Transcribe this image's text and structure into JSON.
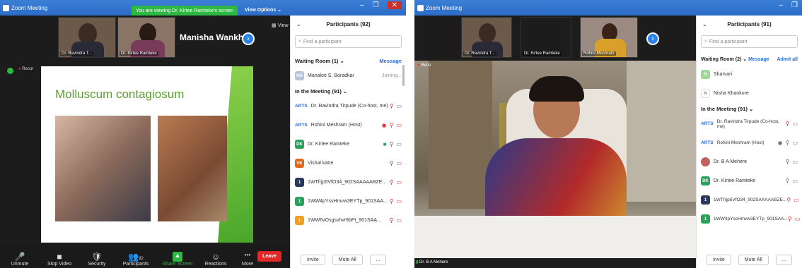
{
  "left": {
    "titlebar": "Zoom Meeting",
    "banner": "You are viewing Dr. Kirtee Ramteke's screen",
    "view_options": "View Options ⌄",
    "view_label": "View",
    "tiles": [
      {
        "name": "Dr. Ravindra T..."
      },
      {
        "name": "Dr. Kirtee Ramteke"
      }
    ],
    "big_name": "Manisha Wankh...",
    "recording": "Recor",
    "slide_title": "Molluscum contagiosum",
    "toolbar": [
      {
        "label": "Unmute",
        "icon": "🎤"
      },
      {
        "label": "Stop Video",
        "icon": "■"
      },
      {
        "label": "Security",
        "icon": "🛡"
      },
      {
        "label": "Participants",
        "icon": "👥",
        "count": "92"
      },
      {
        "label": "Share Screen",
        "icon": "▲"
      },
      {
        "label": "Reactions",
        "icon": "☺"
      },
      {
        "label": "More",
        "icon": "•••"
      }
    ],
    "leave": "Leave",
    "participants": {
      "header": "Participants (92)",
      "search_placeholder": "Find a participant",
      "waiting": "Waiting Room (1)",
      "message": "Message",
      "waiting_rows": [
        {
          "avatar": "MS",
          "name": "Manalee S. Boradkar",
          "status": "Joining..."
        }
      ],
      "in_meeting": "In the Meeting (91)",
      "rows": [
        {
          "avatar": "ARTS",
          "name": "Dr. Ravindra Tirpude (Co-host, me)",
          "color": ""
        },
        {
          "avatar": "ARTS",
          "name": "Rohini Meshram (Host)",
          "color": ""
        },
        {
          "avatar": "DK",
          "name": "Dr. Kirtee Ramteke",
          "color": "#2aa15d"
        },
        {
          "avatar": "VK",
          "name": "Vishal katre",
          "color": "#e06a1a"
        },
        {
          "avatar": "1",
          "name": "1WTfrjp5VfO34_902SAAAAABZE...",
          "color": "#2a3a5a"
        },
        {
          "avatar": "1",
          "name": "1WW4pYssHmvw3EYTp_901SAA...",
          "color": "#2aa15d"
        },
        {
          "avatar": "1",
          "name": "1WW6vOsgsvhvr9bPt_901SAA...",
          "color": "#f0a020"
        }
      ],
      "invite": "Invite",
      "mute_all": "Mute All",
      "more": "..."
    }
  },
  "right": {
    "titlebar": "Zoom Meeting",
    "tiles": [
      {
        "name": "Dr. Ravindra T..."
      },
      {
        "name": "Dr. Kirtee Ramteke"
      },
      {
        "name": "Rohini Meshram"
      }
    ],
    "speaker_name": "Dr. B A Mehere",
    "recording": "Reco",
    "participants": {
      "header": "Participants (91)",
      "search_placeholder": "Find a participant",
      "waiting": "Waiting Room (2)",
      "message": "Message",
      "admit_all": "Admit all",
      "waiting_rows": [
        {
          "avatar": "S",
          "name": "Sharvari",
          "color": "#9ed99b"
        },
        {
          "avatar": "N",
          "name": "Nisha Khankure",
          "color": "#ffffff"
        }
      ],
      "in_meeting": "In the Meeting (91)",
      "rows": [
        {
          "avatar": "ARTS",
          "name": "Dr. Ravindra Tirpude (Co-host, me)",
          "color": ""
        },
        {
          "avatar": "ARTS",
          "name": "Rohini Meshram (Host)",
          "color": ""
        },
        {
          "avatar": "",
          "name": "Dr. B A Mehere",
          "color": "#c06060"
        },
        {
          "avatar": "DK",
          "name": "Dr. Kirtee Ramteke",
          "color": "#2aa15d"
        },
        {
          "avatar": "1",
          "name": "1WTfrjp5VfO34_902SAAAAABZE...",
          "color": "#2a3a5a"
        },
        {
          "avatar": "1",
          "name": "1WW4pYssHmvw3EYTp_901SAA...",
          "color": "#2aa15d"
        }
      ],
      "invite": "Invite",
      "mute_all": "Mute All",
      "more": "..."
    }
  }
}
